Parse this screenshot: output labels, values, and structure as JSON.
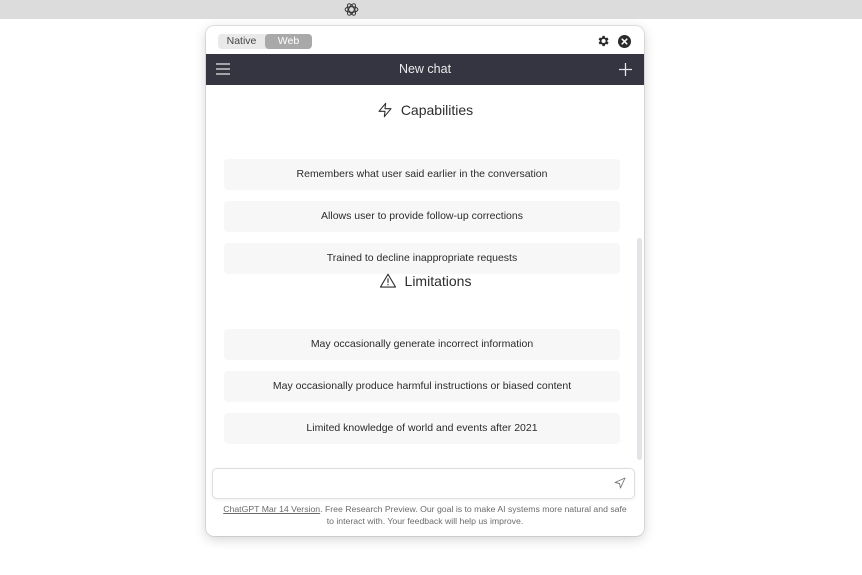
{
  "toggle": {
    "native_label": "Native",
    "web_label": "Web"
  },
  "header": {
    "title": "New chat"
  },
  "capabilities": {
    "title": "Capabilities",
    "items": [
      "Remembers what user said earlier in the conversation",
      "Allows user to provide follow-up corrections",
      "Trained to decline inappropriate requests"
    ]
  },
  "limitations": {
    "title": "Limitations",
    "items": [
      "May occasionally generate incorrect information",
      "May occasionally produce harmful instructions or biased content",
      "Limited knowledge of world and events after 2021"
    ]
  },
  "input": {
    "value": "",
    "placeholder": ""
  },
  "footer": {
    "link_text": "ChatGPT Mar 14 Version",
    "text": ". Free Research Preview. Our goal is to make AI systems more natural and safe to interact with. Your feedback will help us improve."
  },
  "icons": {
    "menubar": "openai-logo-icon",
    "settings": "gear-icon",
    "close": "close-icon",
    "menu": "hamburger-icon",
    "new_chat": "plus-icon",
    "capabilities": "lightning-icon",
    "limitations": "warning-triangle-icon",
    "send": "send-icon"
  },
  "colors": {
    "header_bg": "#343541",
    "card_bg": "#f7f7f8",
    "menubar_bg": "#dcdcdc"
  }
}
